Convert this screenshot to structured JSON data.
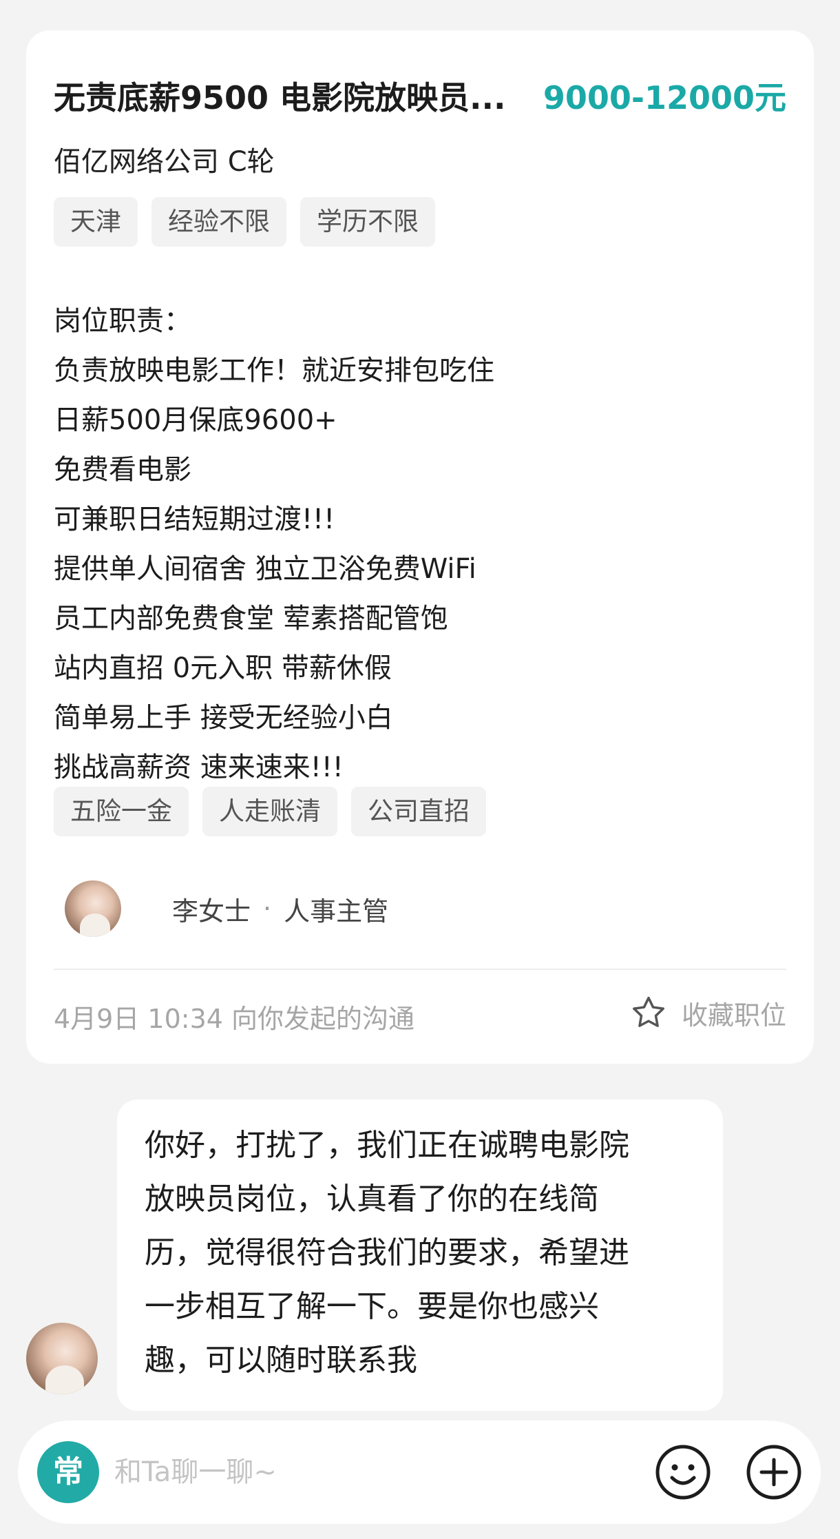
{
  "job": {
    "title": "无责底薪9500 电影院放映员...",
    "salary": "9000-12000元",
    "company": "佰亿网络公司 C轮",
    "tags": [
      "天津",
      "经验不限",
      "学历不限"
    ],
    "description": [
      "岗位职责：",
      "负责放映电影工作！就近安排包吃住",
      "日薪500月保底9600+",
      "免费看电影",
      "可兼职日结短期过渡!!!",
      "提供单人间宿舍 独立卫浴免费WiFi",
      "员工内部免费食堂 荤素搭配管饱",
      "站内直招 0元入职 带薪休假",
      "简单易上手 接受无经验小白",
      "挑战高薪资 速来速来!!!"
    ],
    "benefits": [
      "五险一金",
      "人走账清",
      "公司直招"
    ],
    "recruiter": {
      "name": "李女士",
      "separator": "·",
      "role": "人事主管"
    },
    "contact_time": "4月9日 10:34 向你发起的沟通",
    "favorite_label": "收藏职位"
  },
  "chat": {
    "message_lines": [
      "你好，打扰了，我们正在诚聘电影院",
      "放映员岗位，认真看了你的在线简",
      "历，觉得很符合我们的要求，希望进",
      "一步相互了解一下。要是你也感兴",
      "趣，可以随时联系我"
    ]
  },
  "input_bar": {
    "badge": "常",
    "placeholder": "和Ta聊一聊~",
    "value": ""
  },
  "colors": {
    "accent": "#1aa9a7",
    "badge": "#22aaa6",
    "background": "#f3f3f3"
  },
  "icons": {
    "favorite": "star-outline-icon",
    "emoji": "smiley-icon",
    "plus": "plus-circle-icon"
  }
}
